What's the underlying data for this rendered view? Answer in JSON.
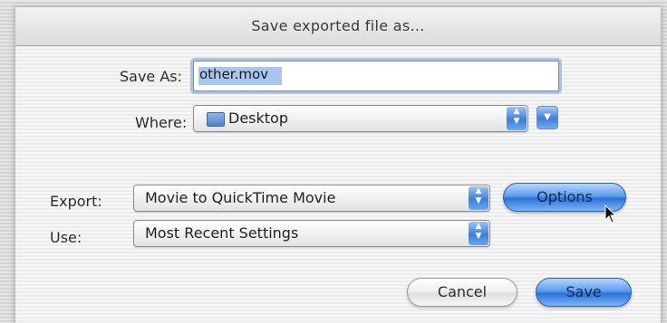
{
  "dialog": {
    "title": "Save exported file as...",
    "save_as_label": "Save As:",
    "save_as_value": "other.mov",
    "where_label": "Where:",
    "where_value": "Desktop",
    "export_label": "Export:",
    "export_value": "Movie to QuickTime Movie",
    "use_label": "Use:",
    "use_value": "Most Recent Settings",
    "options_label": "Options",
    "cancel_label": "Cancel",
    "save_label": "Save"
  },
  "icons": {
    "folder": "folder-icon",
    "popup_arrows": "updown-arrows-icon",
    "expand": "chevron-down-icon",
    "cursor": "mouse-pointer-icon"
  },
  "colors": {
    "accent_blue": "#3c7fdc",
    "selection": "#a9c6ee",
    "focus_ring": "#a9c4ea"
  }
}
